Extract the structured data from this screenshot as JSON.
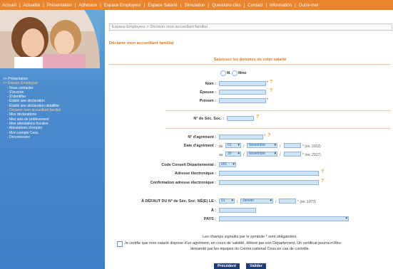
{
  "topnav": {
    "items": [
      "Accueil",
      "Actualité",
      "Présentation",
      "Adhésion",
      "Espace Employeur",
      "Espace Salarié",
      "Simulation",
      "Questions clés",
      "Contact",
      "Information",
      "Outre-mer"
    ],
    "separator": "|"
  },
  "sidebar": {
    "items": [
      {
        "label": ">> Présentation",
        "type": "top"
      },
      {
        "label": ">> Espace Employeur",
        "type": "top-active"
      },
      {
        "label": "- Nous contacter",
        "type": "sub"
      },
      {
        "label": "- S'inscrire",
        "type": "sub"
      },
      {
        "label": "- S'identifier",
        "type": "sub"
      },
      {
        "label": "- Établir une déclaration",
        "type": "sub"
      },
      {
        "label": "- Établir une déclaration détaillée",
        "type": "sub"
      },
      {
        "label": "- Déclarer mon accueillant familial",
        "type": "sub-active"
      },
      {
        "label": "- Mes déclarations",
        "type": "sub"
      },
      {
        "label": "- Mes avis de prélèvement",
        "type": "sub"
      },
      {
        "label": "- Mes attestations fiscales",
        "type": "sub"
      },
      {
        "label": "- Attestations d'emploi",
        "type": "sub"
      },
      {
        "label": "- Mon compte Cesu",
        "type": "sub"
      },
      {
        "label": "- Déconnexion",
        "type": "sub"
      }
    ]
  },
  "breadcrumb": "Espace Employeur > Déclarer mon accueillant familial",
  "page_title": "Déclarer mon accueillant familial",
  "section_title": "Saisissez les données de votre salarié",
  "form": {
    "civility": {
      "option_m": "M.",
      "option_mme": "Mme"
    },
    "nom_label": "Nom :",
    "epouse_label": "Épouse :",
    "prenom_label": "Prénom :",
    "secu_label": "N° de Séc. Soc. :",
    "agrement_label": "N° d'agrément :",
    "date_agrement_label": "Date d'agrément :",
    "date_from": {
      "prefix": "du",
      "day": "01",
      "month": "Novembre",
      "slash": "/",
      "example": "* (ex: 2012)"
    },
    "date_to": {
      "prefix": "au",
      "day": "30",
      "month": "Novembre",
      "slash": "/",
      "example": "* (ex: 2017)"
    },
    "code_dept_label": "Code Conseil Départemental :",
    "code_dept_value": "001",
    "email_label": "Adresse électronique :",
    "email_confirm_label": "Confirmation adresse électronique :",
    "birth_label": "À DÉFAUT DU N° de Séc. Soc. NÉ(E) LE :",
    "birth": {
      "day": "01",
      "month": "Janvier",
      "slash": "/",
      "example": "* (ex: 1973)"
    },
    "a_label": "À :",
    "pays_label": "PAYS :",
    "required_mark": "*",
    "help_mark": "?"
  },
  "mandatory_note": "Les champs signalés par le symbole * sont obligatoires.",
  "certify_text_1": "Je certifie que mon salarié dispose d'un agrément, en cours de validité, délivré par son Département. Un certificat pourra m'être",
  "certify_text_2": "demandé par les équipes du Centre national Cesu en cas de contrôle.",
  "buttons": {
    "previous": "Précédent",
    "validate": "Valider"
  },
  "colors": {
    "nav_orange": "#e9852f",
    "sidebar_blue": "#4d8ccd",
    "title_orange": "#e07a1f",
    "field_blue": "#cfe4f7",
    "button_navy": "#1f3d73"
  }
}
